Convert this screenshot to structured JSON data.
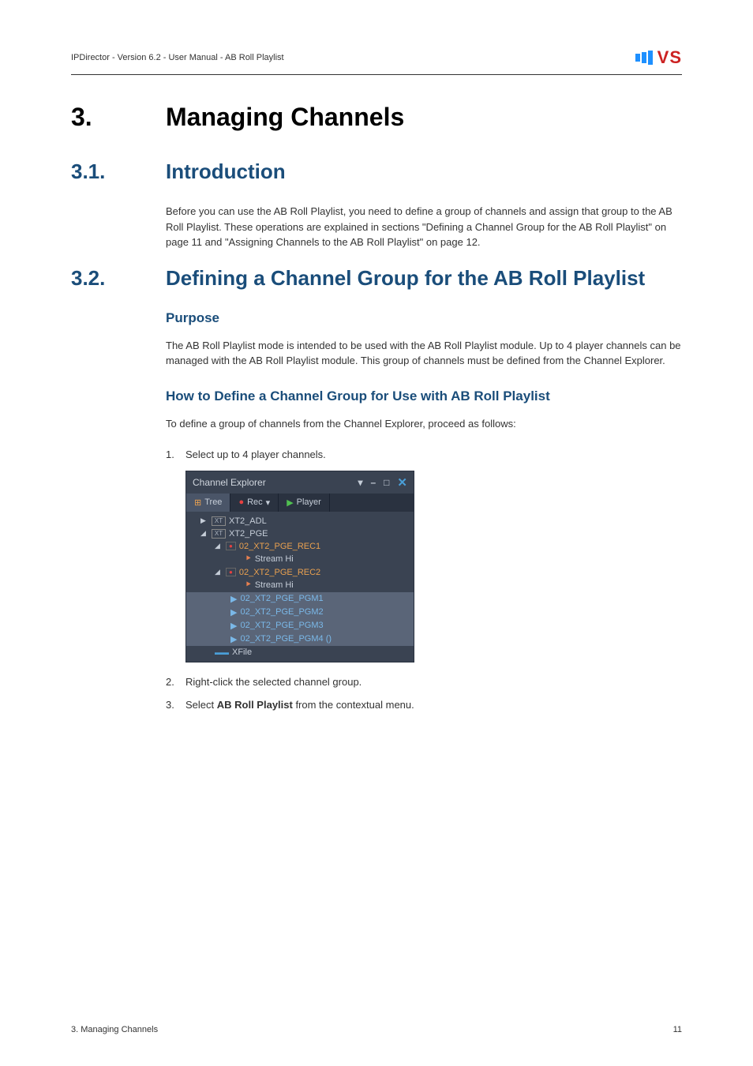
{
  "header": {
    "doc_title": "IPDirector - Version 6.2 - User Manual - AB Roll Playlist",
    "logo": "VS"
  },
  "chapter": {
    "number": "3.",
    "title": "Managing Channels"
  },
  "section1": {
    "number": "3.1.",
    "title": "Introduction",
    "body": "Before you can use the AB Roll Playlist, you need to define a group of channels and assign that group to the AB Roll Playlist. These operations are explained in sections \"Defining a Channel Group for the AB Roll Playlist\" on page 11 and \"Assigning Channels to the AB Roll Playlist\" on page 12."
  },
  "section2": {
    "number": "3.2.",
    "title": "Defining a Channel Group for the AB Roll Playlist",
    "purpose_heading": "Purpose",
    "purpose_body": "The AB Roll Playlist mode is intended to be used with the AB Roll Playlist module. Up to 4 player channels can be managed with the AB Roll Playlist module. This group of channels must be defined from the Channel Explorer.",
    "howto_heading": "How to Define a Channel Group for Use with AB Roll Playlist",
    "howto_intro": "To define a group of channels from the Channel Explorer, proceed as follows:",
    "steps": [
      {
        "num": "1.",
        "text": "Select up to 4 player channels."
      },
      {
        "num": "2.",
        "text": "Right-click the selected channel group."
      },
      {
        "num": "3.",
        "text_pre": "Select ",
        "text_bold": "AB Roll Playlist",
        "text_post": " from the contextual menu."
      }
    ]
  },
  "screenshot": {
    "title": "Channel Explorer",
    "tabs": {
      "tree": "Tree",
      "rec": "Rec",
      "player": "Player"
    },
    "tree": {
      "xt2_adl": "XT2_ADL",
      "xt2_pge": "XT2_PGE",
      "rec1": "02_XT2_PGE_REC1",
      "stream1": "Stream Hi",
      "rec2": "02_XT2_PGE_REC2",
      "stream2": "Stream Hi",
      "pgm1": "02_XT2_PGE_PGM1",
      "pgm2": "02_XT2_PGE_PGM2",
      "pgm3": "02_XT2_PGE_PGM3",
      "pgm4": "02_XT2_PGE_PGM4 ()",
      "xfile": "XFile"
    }
  },
  "footer": {
    "left": "3. Managing Channels",
    "right": "11"
  }
}
